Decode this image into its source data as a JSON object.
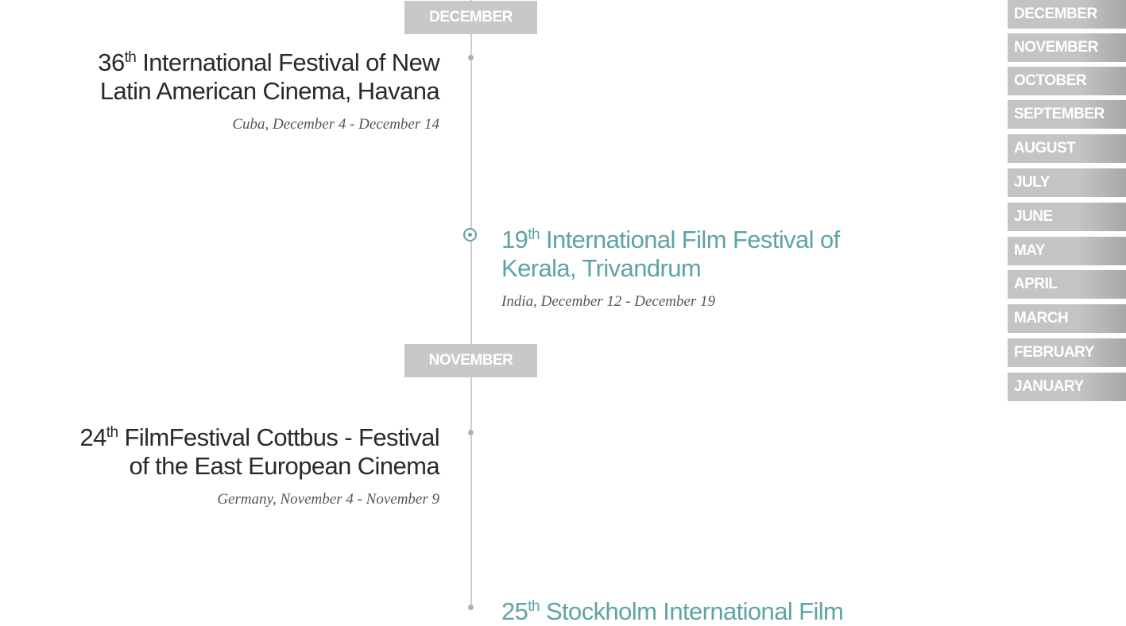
{
  "timeline": {
    "months": [
      {
        "label": "DECEMBER"
      },
      {
        "label": "NOVEMBER"
      }
    ],
    "events": [
      {
        "number": "36",
        "suffix": "th",
        "title_line1": "International Festival of New",
        "title_line2": "Latin American Cinema, Havana",
        "meta": "Cuba, December 4 - December 14"
      },
      {
        "number": "19",
        "suffix": "th",
        "title_line1": "International Film Festival of",
        "title_line2": "Kerala, Trivandrum",
        "meta": "India, December 12 - December 19"
      },
      {
        "number": "24",
        "suffix": "th",
        "title_line1": "FilmFestival Cottbus - Festival",
        "title_line2": "of the East European Cinema",
        "meta": "Germany, November 4 - November 9"
      },
      {
        "number": "25",
        "suffix": "th",
        "title_line1": "Stockholm International Film"
      }
    ]
  },
  "nav": {
    "items": [
      {
        "label": "DECEMBER"
      },
      {
        "label": "NOVEMBER"
      },
      {
        "label": "OCTOBER"
      },
      {
        "label": "SEPTEMBER"
      },
      {
        "label": "AUGUST"
      },
      {
        "label": "JULY"
      },
      {
        "label": "JUNE"
      },
      {
        "label": "MAY"
      },
      {
        "label": "APRIL"
      },
      {
        "label": "MARCH"
      },
      {
        "label": "FEBRUARY"
      },
      {
        "label": "JANUARY"
      }
    ]
  },
  "colors": {
    "accent": "#5fa3a3",
    "header_bg": "#c8c8c8",
    "line": "#cfcfcf"
  }
}
